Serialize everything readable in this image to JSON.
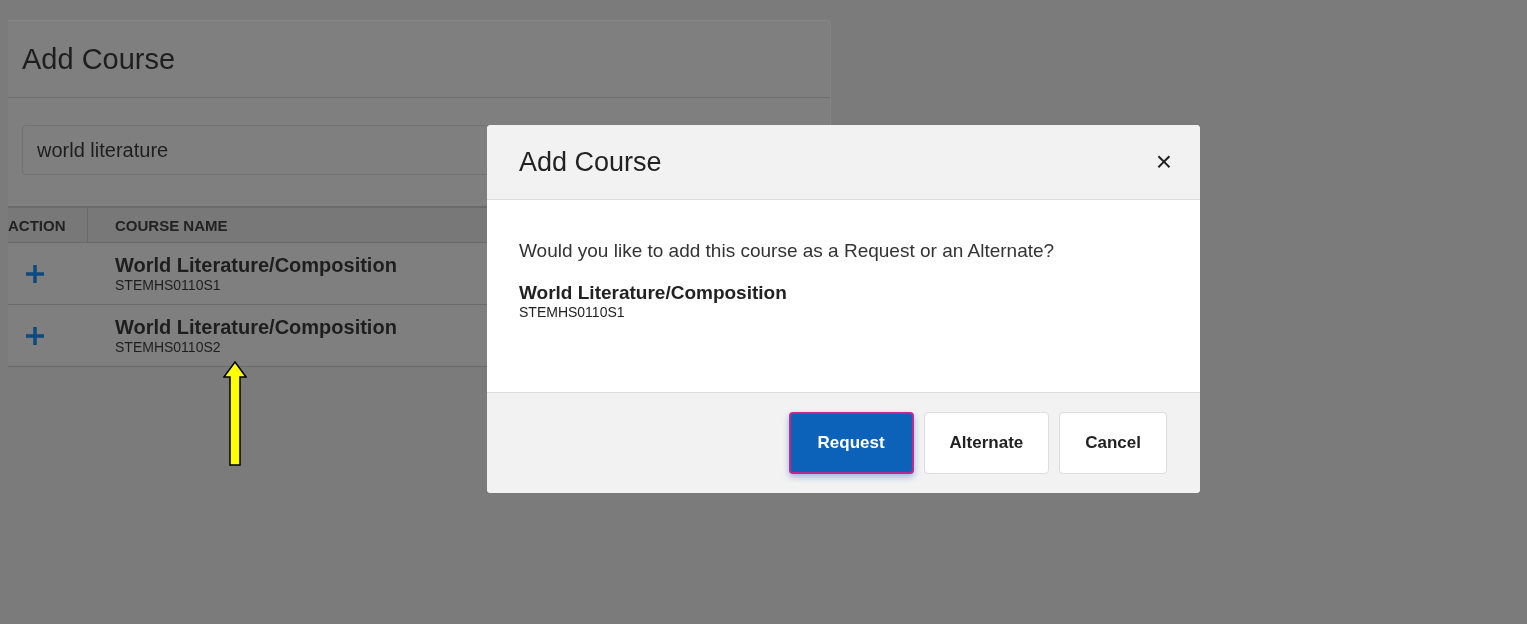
{
  "page": {
    "title": "Add Course",
    "search": {
      "value": "world literature"
    },
    "table": {
      "columns": [
        "ACTION",
        "COURSE NAME"
      ],
      "rows": [
        {
          "name": "World Literature/Composition",
          "code": "STEMHS0110S1"
        },
        {
          "name": "World Literature/Composition",
          "code": "STEMHS0110S2"
        }
      ]
    }
  },
  "dialog": {
    "title": "Add Course",
    "close": "×",
    "message": "Would you like to add this course as a Request or an Alternate?",
    "course": {
      "name": "World Literature/Composition",
      "code": "STEMHS0110S1"
    },
    "buttons": [
      {
        "label": "Request",
        "kind": "primary",
        "focused": true
      },
      {
        "label": "Alternate",
        "kind": "secondary",
        "focused": false
      },
      {
        "label": "Cancel",
        "kind": "secondary",
        "focused": false
      }
    ]
  }
}
